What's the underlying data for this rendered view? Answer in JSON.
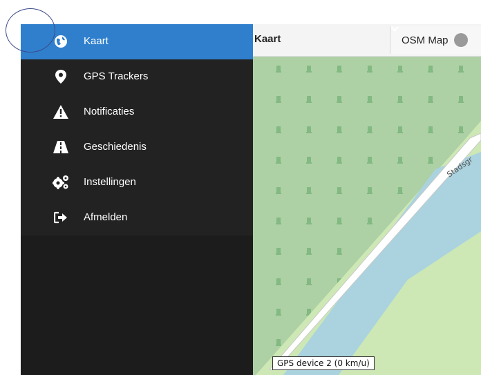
{
  "app": {
    "accent_color": "#2f7fcd",
    "sidebar_color": "#222222"
  },
  "map": {
    "title": "Kaart",
    "layer_select": {
      "value": "OSM Map",
      "icon": "chevron-down-icon"
    },
    "street_label": "Stadsgr",
    "device_label": "GPS device 2 (0 km/u)"
  },
  "menu": {
    "items": [
      {
        "label": "Kaart",
        "icon": "globe-icon",
        "active": true
      },
      {
        "label": "GPS Trackers",
        "icon": "map-marker-icon",
        "active": false
      },
      {
        "label": "Notificaties",
        "icon": "warning-icon",
        "active": false
      },
      {
        "label": "Geschiedenis",
        "icon": "road-icon",
        "active": false
      },
      {
        "label": "Instellingen",
        "icon": "gears-icon",
        "active": false
      },
      {
        "label": "Afmelden",
        "icon": "sign-out-icon",
        "active": false
      }
    ]
  }
}
